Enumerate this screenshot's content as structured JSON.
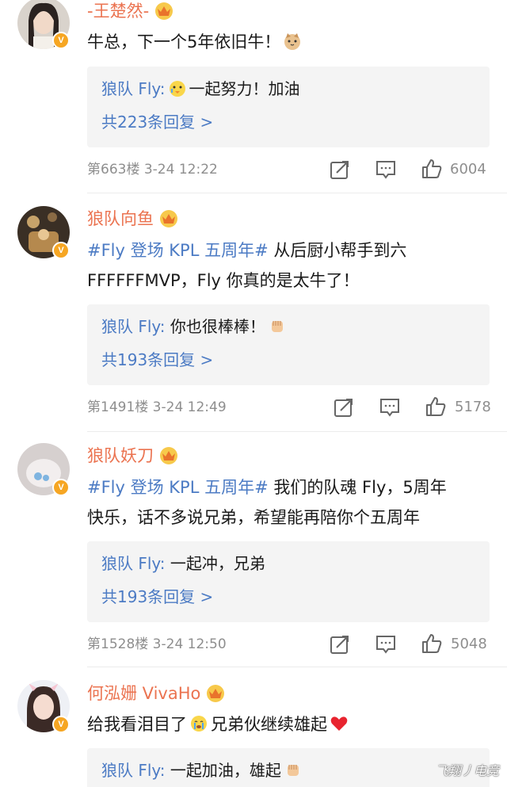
{
  "comments": [
    {
      "username": "-王楚然-",
      "text": "牛总，下一个5年依旧牛！",
      "reply_name": "狼队 Fly:",
      "reply_text": "一起努力！加油",
      "reply_count": "共223条回复 >",
      "floor": "第663楼",
      "time": "3-24 12:22",
      "likes": "6004"
    },
    {
      "username": "狼队向鱼",
      "topic": "#Fly 登场 KPL 五周年#",
      "text": " 从后厨小帮手到六",
      "text2": "FFFFFFMVP，Fly 你真的是太牛了！",
      "reply_name": "狼队 Fly:",
      "reply_text": "你也很棒棒！",
      "reply_count": "共193条回复 >",
      "floor": "第1491楼",
      "time": "3-24 12:49",
      "likes": "5178"
    },
    {
      "username": "狼队妖刀",
      "topic": "#Fly 登场 KPL 五周年#",
      "text": " 我们的队魂 Fly，5周年",
      "text2": "快乐，话不多说兄弟，希望能再陪你个五周年",
      "reply_name": "狼队 Fly:",
      "reply_text": "一起冲，兄弟",
      "reply_count": "共193条回复 >",
      "floor": "第1528楼",
      "time": "3-24 12:50",
      "likes": "5048"
    },
    {
      "username": "何泓姗 VivaHo",
      "text_a": "给我看泪目了",
      "text_b": "兄弟伙继续雄起",
      "reply_name": "狼队 Fly:",
      "reply_text": "一起加油，雄起"
    }
  ],
  "icons": {
    "share": "share-icon",
    "comment": "comment-icon",
    "like": "thumbs-up-icon"
  },
  "colors": {
    "username": "#eb7350",
    "link": "#4c7bc4",
    "meta": "#8e8e8e",
    "reply_bg": "#f4f4f4"
  },
  "watermark": "飞翔丿电竞"
}
